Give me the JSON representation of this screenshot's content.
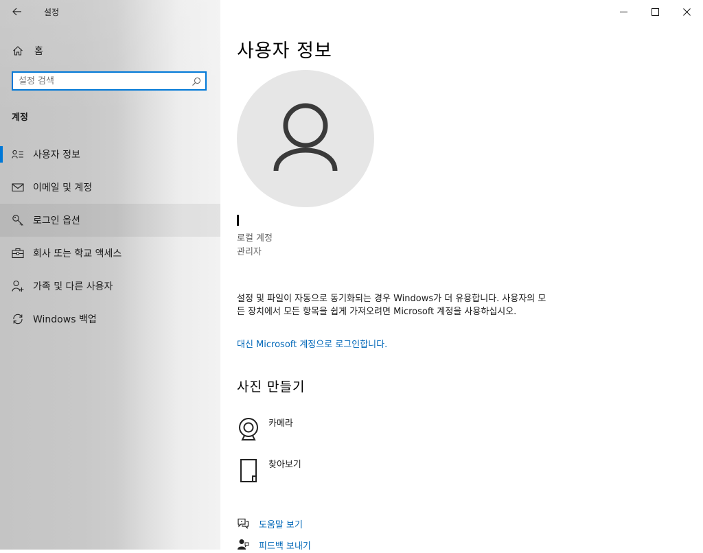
{
  "app": {
    "title": "설정"
  },
  "window_controls": {
    "minimize": "minimize",
    "maximize": "maximize",
    "close": "close"
  },
  "sidebar": {
    "home_label": "홈",
    "search_placeholder": "설정 검색",
    "section_label": "계정",
    "items": [
      {
        "label": "사용자 정보",
        "icon": "user-info-icon",
        "selected": true
      },
      {
        "label": "이메일 및 계정",
        "icon": "mail-icon"
      },
      {
        "label": "로그인 옵션",
        "icon": "key-icon",
        "hover": true
      },
      {
        "label": "회사 또는 학교 액세스",
        "icon": "briefcase-icon"
      },
      {
        "label": "가족 및 다른 사용자",
        "icon": "add-person-icon"
      },
      {
        "label": "Windows 백업",
        "icon": "sync-icon"
      }
    ]
  },
  "main": {
    "title": "사용자 정보",
    "account_type": "로컬 계정",
    "account_role": "관리자",
    "description": "설정 및 파일이 자동으로 동기화되는 경우 Windows가 더 유용합니다. 사용자의 모든 장치에서 모든 항목을 쉽게 가져오려면 Microsoft 계정을 사용하십시오.",
    "ms_link": "대신 Microsoft 계정으로 로그인합니다.",
    "create_picture": {
      "title": "사진 만들기",
      "options": [
        {
          "label": "카메라",
          "icon": "camera-icon"
        },
        {
          "label": "찾아보기",
          "icon": "browse-icon"
        }
      ]
    },
    "help": [
      {
        "label": "도움말 보기",
        "icon": "help-chat-icon"
      },
      {
        "label": "피드백 보내기",
        "icon": "feedback-icon"
      }
    ]
  },
  "colors": {
    "accent": "#0078d7",
    "link": "#0067b8"
  }
}
